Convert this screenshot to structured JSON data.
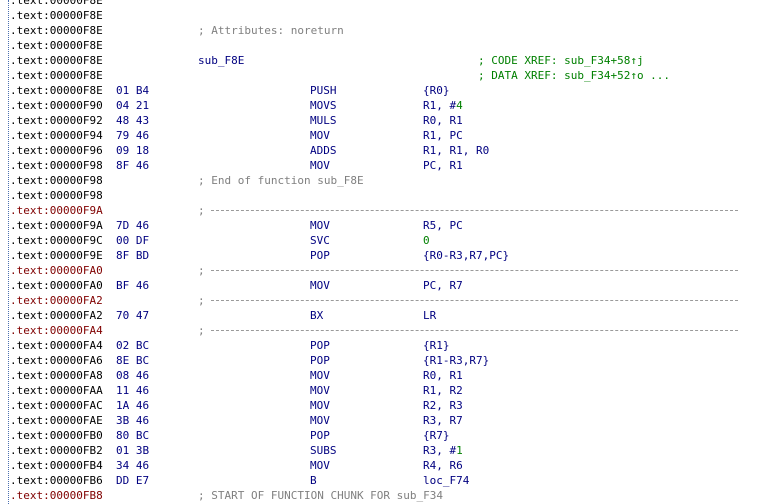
{
  "view": "IDA View - disassembly",
  "lines": [
    {
      "addr": ".text:00000F8E",
      "red": false,
      "kind": "blank"
    },
    {
      "addr": ".text:00000F8E",
      "red": false,
      "kind": "blank"
    },
    {
      "addr": ".text:00000F8E",
      "red": false,
      "kind": "comment",
      "text": "; Attributes: noreturn"
    },
    {
      "addr": ".text:00000F8E",
      "red": false,
      "kind": "blank"
    },
    {
      "addr": ".text:00000F8E",
      "red": false,
      "kind": "label",
      "label": "sub_F8E",
      "xref": "; CODE XREF: sub_F34+58↑j"
    },
    {
      "addr": ".text:00000F8E",
      "red": false,
      "kind": "xref",
      "xref": "; DATA XREF: sub_F34+52↑o ..."
    },
    {
      "addr": ".text:00000F8E",
      "red": false,
      "kind": "instr",
      "bytes": "01 B4",
      "mnem": "PUSH",
      "ops": "{R0}"
    },
    {
      "addr": ".text:00000F90",
      "red": false,
      "kind": "instr",
      "bytes": "04 21",
      "mnem": "MOVS",
      "ops": "R1, #",
      "num": "4"
    },
    {
      "addr": ".text:00000F92",
      "red": false,
      "kind": "instr",
      "bytes": "48 43",
      "mnem": "MULS",
      "ops": "R0, R1"
    },
    {
      "addr": ".text:00000F94",
      "red": false,
      "kind": "instr",
      "bytes": "79 46",
      "mnem": "MOV",
      "ops": "R1, PC"
    },
    {
      "addr": ".text:00000F96",
      "red": false,
      "kind": "instr",
      "bytes": "09 18",
      "mnem": "ADDS",
      "ops": "R1, R1, R0"
    },
    {
      "addr": ".text:00000F98",
      "red": false,
      "kind": "instr",
      "bytes": "8F 46",
      "mnem": "MOV",
      "ops": "PC, R1"
    },
    {
      "addr": ".text:00000F98",
      "red": false,
      "kind": "comment",
      "text": "; End of function sub_F8E"
    },
    {
      "addr": ".text:00000F98",
      "red": false,
      "kind": "blank"
    },
    {
      "addr": ".text:00000F9A",
      "red": true,
      "kind": "sep",
      "text": ";"
    },
    {
      "addr": ".text:00000F9A",
      "red": false,
      "kind": "instr",
      "bytes": "7D 46",
      "mnem": "MOV",
      "ops": "R5, PC"
    },
    {
      "addr": ".text:00000F9C",
      "red": false,
      "kind": "instr",
      "bytes": "00 DF",
      "mnem": "SVC",
      "ops": "",
      "num": "0"
    },
    {
      "addr": ".text:00000F9E",
      "red": false,
      "kind": "instr",
      "bytes": "8F BD",
      "mnem": "POP",
      "ops": "{R0-R3,R7,PC}"
    },
    {
      "addr": ".text:00000FA0",
      "red": true,
      "kind": "sep",
      "text": ";"
    },
    {
      "addr": ".text:00000FA0",
      "red": false,
      "kind": "instr",
      "bytes": "BF 46",
      "mnem": "MOV",
      "ops": "PC, R7"
    },
    {
      "addr": ".text:00000FA2",
      "red": true,
      "kind": "sep",
      "text": ";"
    },
    {
      "addr": ".text:00000FA2",
      "red": false,
      "kind": "instr",
      "bytes": "70 47",
      "mnem": "BX",
      "ops": "LR"
    },
    {
      "addr": ".text:00000FA4",
      "red": true,
      "kind": "sep",
      "text": ";"
    },
    {
      "addr": ".text:00000FA4",
      "red": false,
      "kind": "instr",
      "bytes": "02 BC",
      "mnem": "POP",
      "ops": "{R1}"
    },
    {
      "addr": ".text:00000FA6",
      "red": false,
      "kind": "instr",
      "bytes": "8E BC",
      "mnem": "POP",
      "ops": "{R1-R3,R7}"
    },
    {
      "addr": ".text:00000FA8",
      "red": false,
      "kind": "instr",
      "bytes": "08 46",
      "mnem": "MOV",
      "ops": "R0, R1"
    },
    {
      "addr": ".text:00000FAA",
      "red": false,
      "kind": "instr",
      "bytes": "11 46",
      "mnem": "MOV",
      "ops": "R1, R2"
    },
    {
      "addr": ".text:00000FAC",
      "red": false,
      "kind": "instr",
      "bytes": "1A 46",
      "mnem": "MOV",
      "ops": "R2, R3"
    },
    {
      "addr": ".text:00000FAE",
      "red": false,
      "kind": "instr",
      "bytes": "3B 46",
      "mnem": "MOV",
      "ops": "R3, R7"
    },
    {
      "addr": ".text:00000FB0",
      "red": false,
      "kind": "instr",
      "bytes": "80 BC",
      "mnem": "POP",
      "ops": "{R7}"
    },
    {
      "addr": ".text:00000FB2",
      "red": false,
      "kind": "instr",
      "bytes": "01 3B",
      "mnem": "SUBS",
      "ops": "R3, #",
      "num": "1"
    },
    {
      "addr": ".text:00000FB4",
      "red": false,
      "kind": "instr",
      "bytes": "34 46",
      "mnem": "MOV",
      "ops": "R4, R6"
    },
    {
      "addr": ".text:00000FB6",
      "red": false,
      "kind": "instr",
      "bytes": "DD E7",
      "mnem": "B",
      "ops": "loc_F74"
    },
    {
      "addr": ".text:00000FB8",
      "red": true,
      "kind": "sep",
      "text": "; START OF FUNCTION CHUNK FOR sub_F34"
    }
  ]
}
